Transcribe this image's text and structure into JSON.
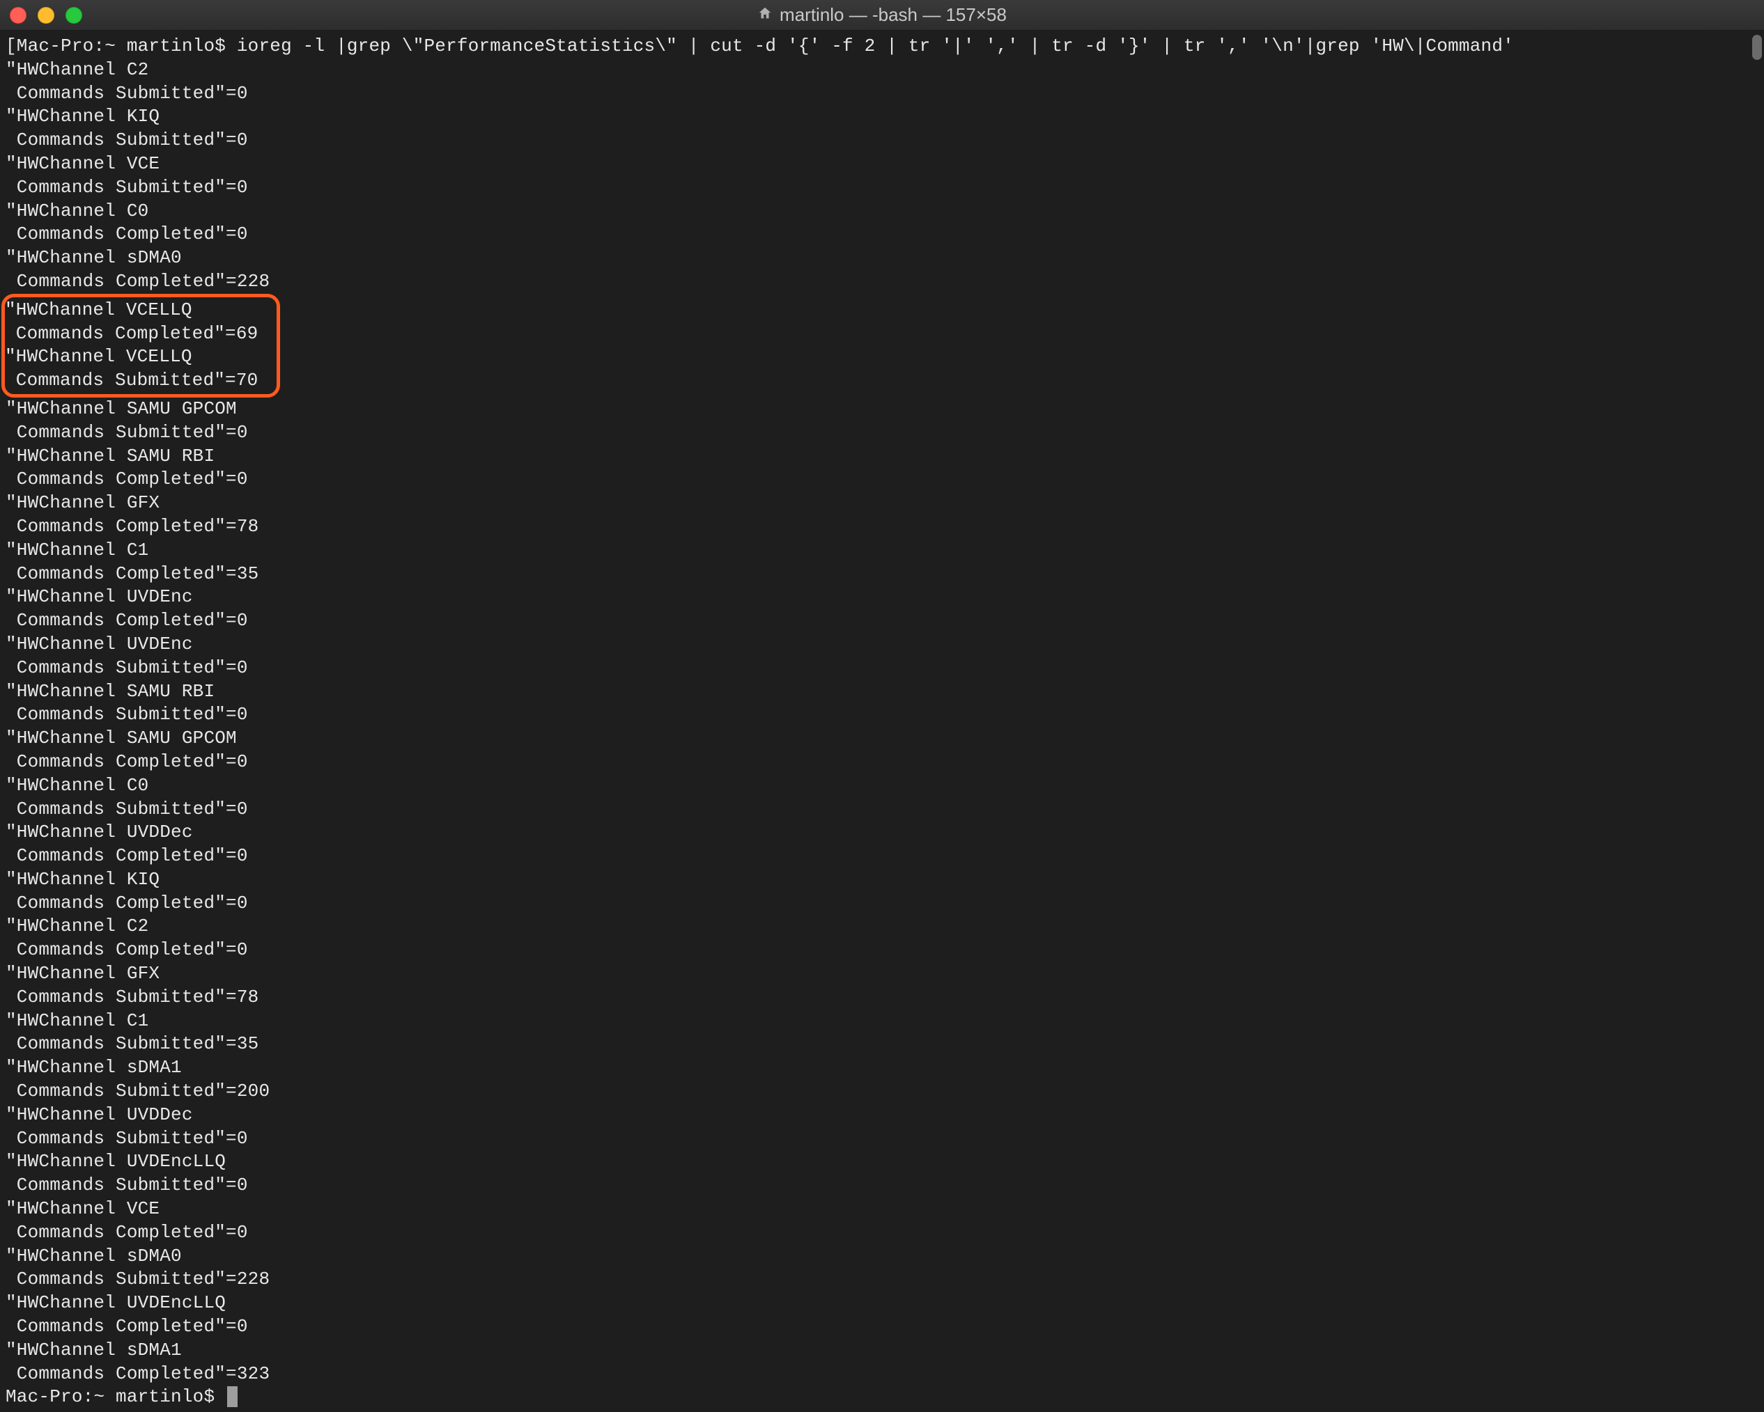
{
  "window": {
    "title": "martinlo — -bash — 157×58"
  },
  "prompt": {
    "host": "Mac-Pro:~",
    "user": "martinlo$",
    "command": "ioreg -l |grep \\\"PerformanceStatistics\\\" | cut -d '{' -f 2 | tr '|' ',' | tr -d '}' | tr ',' '\\n'|grep 'HW\\|Command'"
  },
  "output_lines": [
    "\"HWChannel C2",
    " Commands Submitted\"=0",
    "\"HWChannel KIQ",
    " Commands Submitted\"=0",
    "\"HWChannel VCE",
    " Commands Submitted\"=0",
    "\"HWChannel C0",
    " Commands Completed\"=0",
    "\"HWChannel sDMA0",
    " Commands Completed\"=228"
  ],
  "highlighted_lines": [
    "\"HWChannel VCELLQ",
    " Commands Completed\"=69",
    "\"HWChannel VCELLQ",
    " Commands Submitted\"=70"
  ],
  "output_lines_after": [
    "\"HWChannel SAMU GPCOM",
    " Commands Submitted\"=0",
    "\"HWChannel SAMU RBI",
    " Commands Completed\"=0",
    "\"HWChannel GFX",
    " Commands Completed\"=78",
    "\"HWChannel C1",
    " Commands Completed\"=35",
    "\"HWChannel UVDEnc",
    " Commands Completed\"=0",
    "\"HWChannel UVDEnc",
    " Commands Submitted\"=0",
    "\"HWChannel SAMU RBI",
    " Commands Submitted\"=0",
    "\"HWChannel SAMU GPCOM",
    " Commands Completed\"=0",
    "\"HWChannel C0",
    " Commands Submitted\"=0",
    "\"HWChannel UVDDec",
    " Commands Completed\"=0",
    "\"HWChannel KIQ",
    " Commands Completed\"=0",
    "\"HWChannel C2",
    " Commands Completed\"=0",
    "\"HWChannel GFX",
    " Commands Submitted\"=78",
    "\"HWChannel C1",
    " Commands Submitted\"=35",
    "\"HWChannel sDMA1",
    " Commands Submitted\"=200",
    "\"HWChannel UVDDec",
    " Commands Submitted\"=0",
    "\"HWChannel UVDEncLLQ",
    " Commands Submitted\"=0",
    "\"HWChannel VCE",
    " Commands Completed\"=0",
    "\"HWChannel sDMA0",
    " Commands Submitted\"=228",
    "\"HWChannel UVDEncLLQ",
    " Commands Completed\"=0",
    "\"HWChannel sDMA1",
    " Commands Completed\"=323"
  ],
  "prompt2": {
    "text": "Mac-Pro:~ martinlo$ "
  }
}
